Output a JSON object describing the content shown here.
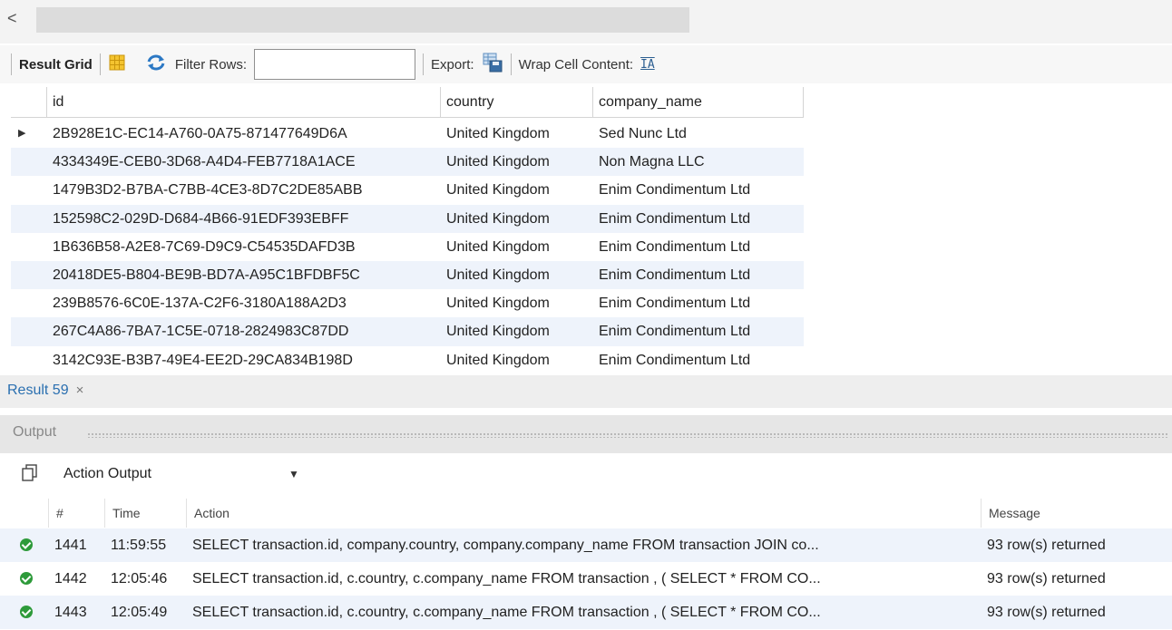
{
  "scroll": {
    "left_arrow": "<"
  },
  "toolbar": {
    "result_grid_label": "Result Grid",
    "filter_label": "Filter Rows:",
    "filter_value": "",
    "export_label": "Export:",
    "wrap_label": "Wrap Cell Content:",
    "wrap_icon_glyph": "IA"
  },
  "grid": {
    "columns": [
      "id",
      "country",
      "company_name"
    ],
    "row_pointer": "▶",
    "rows": [
      {
        "id": "2B928E1C-EC14-A760-0A75-871477649D6A",
        "country": "United Kingdom",
        "company_name": "Sed Nunc Ltd"
      },
      {
        "id": "4334349E-CEB0-3D68-A4D4-FEB7718A1ACE",
        "country": "United Kingdom",
        "company_name": "Non Magna LLC"
      },
      {
        "id": "1479B3D2-B7BA-C7BB-4CE3-8D7C2DE85ABB",
        "country": "United Kingdom",
        "company_name": "Enim Condimentum Ltd"
      },
      {
        "id": "152598C2-029D-D684-4B66-91EDF393EBFF",
        "country": "United Kingdom",
        "company_name": "Enim Condimentum Ltd"
      },
      {
        "id": "1B636B58-A2E8-7C69-D9C9-C54535DAFD3B",
        "country": "United Kingdom",
        "company_name": "Enim Condimentum Ltd"
      },
      {
        "id": "20418DE5-B804-BE9B-BD7A-A95C1BFDBF5C",
        "country": "United Kingdom",
        "company_name": "Enim Condimentum Ltd"
      },
      {
        "id": "239B8576-6C0E-137A-C2F6-3180A188A2D3",
        "country": "United Kingdom",
        "company_name": "Enim Condimentum Ltd"
      },
      {
        "id": "267C4A86-7BA7-1C5E-0718-2824983C87DD",
        "country": "United Kingdom",
        "company_name": "Enim Condimentum Ltd"
      },
      {
        "id": "3142C93E-B3B7-49E4-EE2D-29CA834B198D",
        "country": "United Kingdom",
        "company_name": "Enim Condimentum Ltd"
      }
    ]
  },
  "result_tab": {
    "label": "Result 59",
    "close": "×"
  },
  "output": {
    "title": "Output",
    "selector_value": "Action Output",
    "dropdown_glyph": "▼",
    "columns": [
      "#",
      "Time",
      "Action",
      "Message"
    ],
    "rows": [
      {
        "num": "1441",
        "time": "11:59:55",
        "action": "SELECT transaction.id, company.country, company.company_name FROM transaction  JOIN co...",
        "message": "93 row(s) returned"
      },
      {
        "num": "1442",
        "time": "12:05:46",
        "action": "SELECT transaction.id, c.country, c.company_name FROM transaction , ( SELECT * FROM CO...",
        "message": "93 row(s) returned"
      },
      {
        "num": "1443",
        "time": "12:05:49",
        "action": "SELECT transaction.id, c.country, c.company_name FROM transaction , ( SELECT * FROM CO...",
        "message": "93 row(s) returned"
      }
    ]
  }
}
